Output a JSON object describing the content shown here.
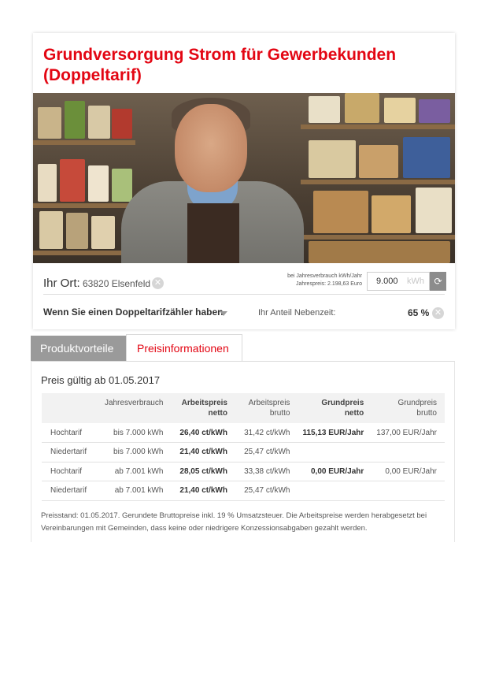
{
  "title": "Grundversorgung Strom für Gewerbekunden (Doppeltarif)",
  "location": {
    "label": "Ihr Ort:",
    "value": "63820 Elsenfeld"
  },
  "consumption": {
    "note_line1": "bei Jahresverbrauch kWh/Jahr",
    "note_line2": "Jahrespreis: 2.198,63 Euro",
    "value": "9.000",
    "unit": "kWh"
  },
  "meter": {
    "label": "Wenn Sie einen Doppeltarifzähler haben",
    "share_label": "Ihr Anteil Nebenzeit:",
    "share_value": "65 %"
  },
  "tabs": [
    {
      "label": "Produktvorteile",
      "active": false
    },
    {
      "label": "Preisinformationen",
      "active": true
    }
  ],
  "price": {
    "valid_from": "Preis gültig ab 01.05.2017",
    "headers": [
      {
        "line1": "",
        "line2": ""
      },
      {
        "line1": "Jahresverbrauch",
        "line2": ""
      },
      {
        "line1": "Arbeitspreis",
        "line2": "netto"
      },
      {
        "line1": "Arbeitspreis",
        "line2": "brutto"
      },
      {
        "line1": "Grundpreis",
        "line2": "netto"
      },
      {
        "line1": "Grundpreis",
        "line2": "brutto"
      }
    ],
    "rows": [
      [
        "Hochtarif",
        "bis 7.000 kWh",
        "26,40 ct/kWh",
        "31,42 ct/kWh",
        "115,13 EUR/Jahr",
        "137,00 EUR/Jahr"
      ],
      [
        "Niedertarif",
        "bis 7.000 kWh",
        "21,40 ct/kWh",
        "25,47 ct/kWh",
        "",
        ""
      ],
      [
        "Hochtarif",
        "ab 7.001 kWh",
        "28,05 ct/kWh",
        "33,38 ct/kWh",
        "0,00 EUR/Jahr",
        "0,00 EUR/Jahr"
      ],
      [
        "Niedertarif",
        "ab 7.001 kWh",
        "21,40 ct/kWh",
        "25,47 ct/kWh",
        "",
        ""
      ]
    ],
    "footnote": "Preisstand: 01.05.2017. Gerundete Bruttopreise inkl. 19 % Umsatzsteuer.  Die Arbeitspreise werden herabgesetzt bei Vereinbarungen mit Gemeinden, dass keine oder niedrigere Konzessionsabgaben gezahlt werden."
  },
  "colors": {
    "brand_red": "#e30613",
    "tab_inactive": "#9a9a9a"
  },
  "icons": {
    "clear": "close-circle-icon",
    "dropdown": "chevron-down-icon",
    "refresh": "refresh-icon"
  }
}
